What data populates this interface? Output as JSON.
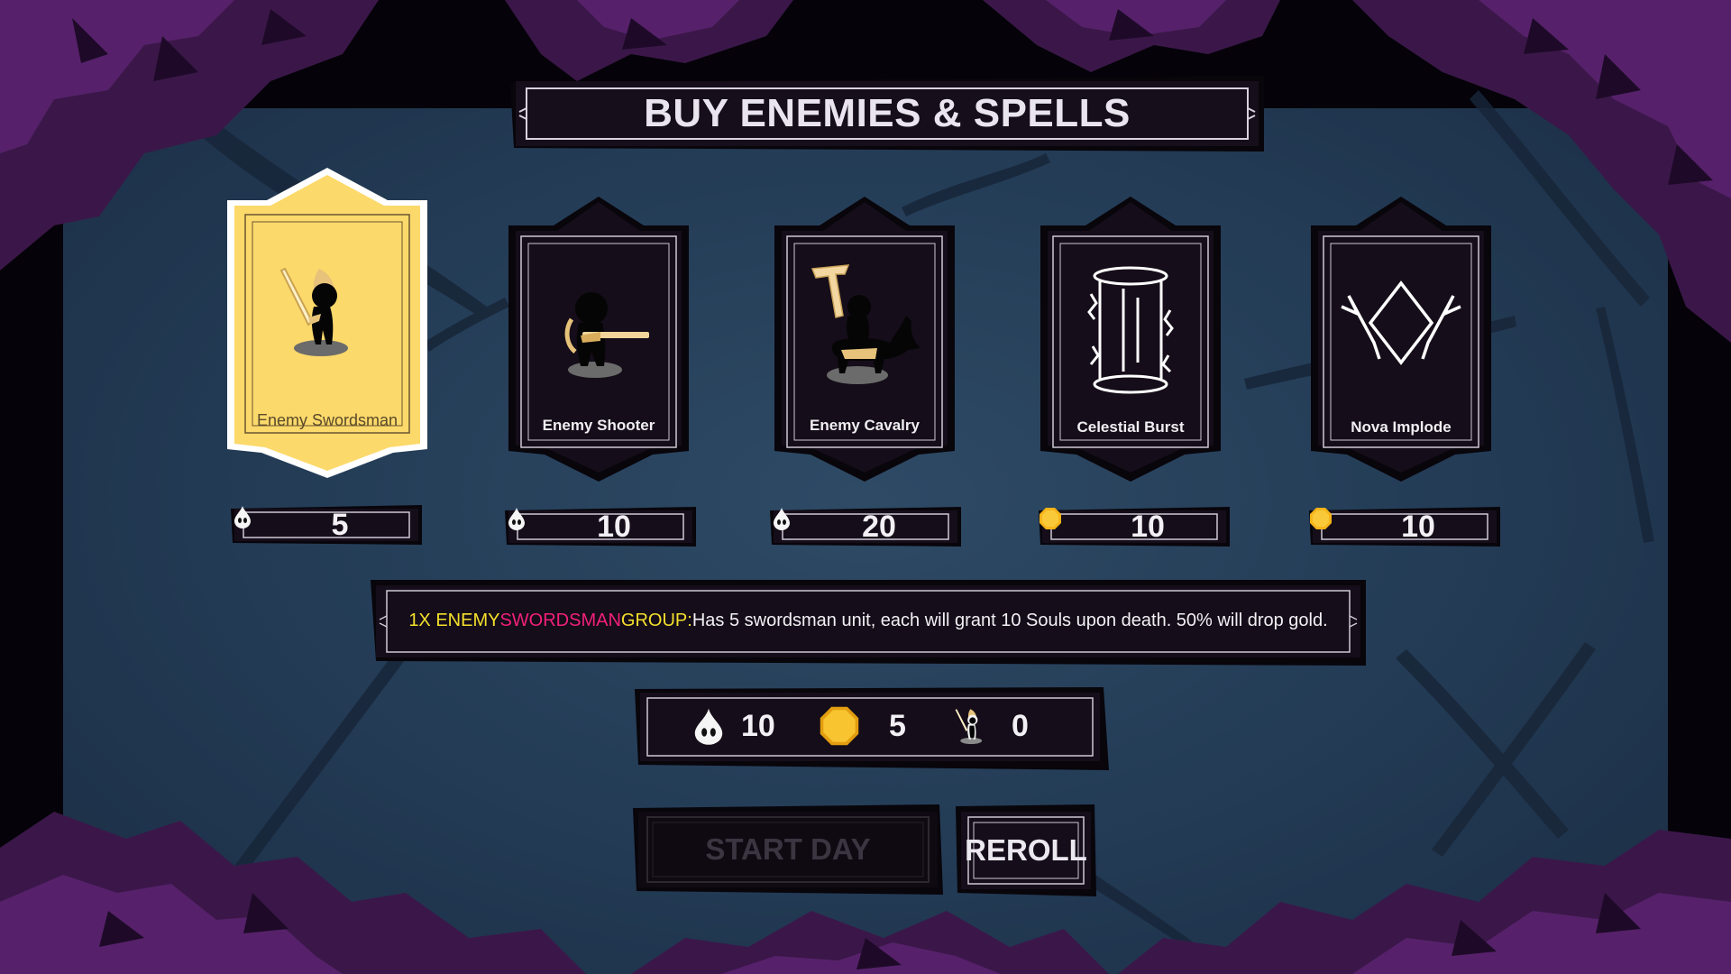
{
  "title": "BUY ENEMIES & SPELLS",
  "colors": {
    "selected_card": "#fcd96b",
    "dark_plate": "#140c18",
    "plate_border": "#cfc8d6",
    "highlight_yellow": "#f4e02c",
    "highlight_pink": "#f2207a",
    "gold": "#f6b418",
    "foliage": "#3a1648",
    "background": "#243c56"
  },
  "cards": [
    {
      "name": "Enemy Swordsman",
      "icon": "swordsman-icon",
      "selected": true,
      "price": "5",
      "currency": "soul-icon"
    },
    {
      "name": "Enemy Shooter",
      "icon": "shooter-icon",
      "selected": false,
      "price": "10",
      "currency": "soul-icon"
    },
    {
      "name": "Enemy Cavalry",
      "icon": "cavalry-icon",
      "selected": false,
      "price": "20",
      "currency": "soul-icon"
    },
    {
      "name": "Celestial Burst",
      "icon": "celestial-burst-icon",
      "selected": false,
      "price": "10",
      "currency": "gold-coin-icon"
    },
    {
      "name": "Nova Implode",
      "icon": "nova-implode-icon",
      "selected": false,
      "price": "10",
      "currency": "gold-coin-icon"
    }
  ],
  "description": {
    "part1": "1X ENEMY ",
    "part2": "SWORDSMAN",
    "part3": " GROUP:",
    "part4": " Has 5 swordsman unit, each will grant 10 Souls upon death. 50% will drop gold."
  },
  "resources": {
    "souls": "10",
    "gold": "5",
    "units": "0"
  },
  "buttons": {
    "start_day": "START DAY",
    "start_day_enabled": false,
    "reroll": "REROLL"
  }
}
